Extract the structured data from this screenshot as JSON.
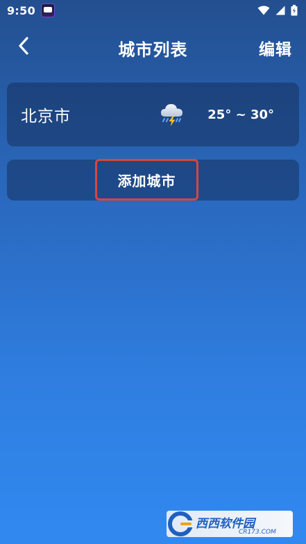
{
  "status_bar": {
    "time": "9:50",
    "icons": [
      "app-notification-icon",
      "wifi-icon",
      "signal-icon",
      "battery-charging-icon"
    ]
  },
  "header": {
    "back_icon": "chevron-left-icon",
    "title": "城市列表",
    "edit_label": "编辑"
  },
  "cities": [
    {
      "name": "北京市",
      "weather_icon": "thunderstorm-icon",
      "temp_range": "25° ~ 30°"
    }
  ],
  "add_city": {
    "label": "添加城市",
    "highlight_color": "#d9463b"
  },
  "watermark": {
    "brand": "西西软件园",
    "domain": "CR173.COM"
  },
  "colors": {
    "background_top": "#234f8f",
    "background_bottom": "#3189f0",
    "card": "#1e3f72",
    "text": "#ffffff"
  }
}
